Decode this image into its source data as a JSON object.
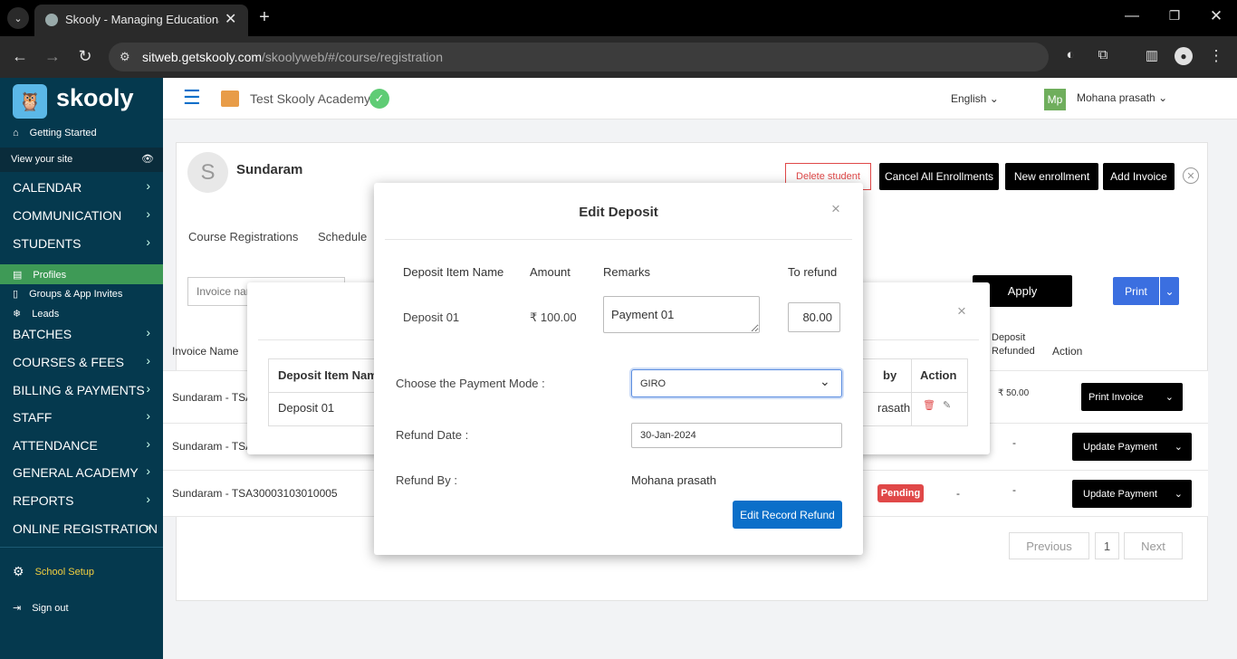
{
  "browser": {
    "tab_title": "Skooly - Managing Educational",
    "url_domain": "sitweb.getskooly.com",
    "url_path": "/skoolyweb/#/course/registration"
  },
  "sidebar": {
    "brand": "skooly",
    "getting_started": "Getting Started",
    "view_site": "View your site",
    "menu": [
      {
        "label": "CALENDAR"
      },
      {
        "label": "COMMUNICATION"
      },
      {
        "label": "STUDENTS"
      }
    ],
    "sub": {
      "profiles": "Profiles",
      "groups": "Groups & App Invites",
      "leads": "Leads"
    },
    "menu2": [
      {
        "label": "BATCHES"
      },
      {
        "label": "COURSES & FEES"
      },
      {
        "label": "BILLING & PAYMENTS"
      },
      {
        "label": "STAFF"
      },
      {
        "label": "ATTENDANCE"
      },
      {
        "label": "GENERAL ACADEMY"
      },
      {
        "label": "REPORTS"
      },
      {
        "label": "ONLINE REGISTRATION"
      }
    ],
    "school_setup": "School Setup",
    "sign_out": "Sign out"
  },
  "header": {
    "academy": "Test Skooly Academy",
    "language": "English",
    "avatar": "Mp",
    "user": "Mohana prasath"
  },
  "student": {
    "initial": "S",
    "name": "Sundaram",
    "delete": "Delete student",
    "cancel_all": "Cancel All Enrollments",
    "new_enroll": "New enrollment",
    "add_invoice": "Add Invoice",
    "tab1": "Course Registrations",
    "tab2": "Schedule",
    "invoice_placeholder": "Invoice name",
    "apply": "Apply",
    "print": "Print"
  },
  "table": {
    "col_invoice": "Invoice Name",
    "col_deposit1": "Deposit",
    "col_deposit2": "Refunded",
    "col_action": "Action",
    "rows": [
      {
        "name": "Sundaram - TSA",
        "deposit": "₹ 50.00",
        "action": "Print Invoice"
      },
      {
        "name": "Sundaram - TSA",
        "deposit": "-",
        "action": "Update Payment"
      },
      {
        "name": "Sundaram - TSA30003103010005",
        "status": "Pending",
        "dash": "-",
        "deposit": "-",
        "action": "Update Payment"
      }
    ],
    "prev": "Previous",
    "page": "1",
    "next": "Next"
  },
  "back_modal": {
    "col1": "Deposit Item Name",
    "col_by": "by",
    "col_action": "Action",
    "item": "Deposit 01",
    "by_val": "rasath"
  },
  "modal": {
    "title": "Edit Deposit",
    "h_item": "Deposit Item Name",
    "h_amount": "Amount",
    "h_remarks": "Remarks",
    "h_refund": "To refund",
    "item": "Deposit 01",
    "amount": "₹ 100.00",
    "remarks": "Payment 01",
    "refund": "80.00",
    "mode_label": "Choose the Payment Mode :",
    "mode_value": "GIRO",
    "date_label": "Refund Date :",
    "date_value": "30-Jan-2024",
    "by_label": "Refund By :",
    "by_value": "Mohana prasath",
    "submit": "Edit Record Refund"
  },
  "colors": {
    "sidebar": "#05394e",
    "accent": "#0b6fc9",
    "active": "#3e9a56",
    "pending": "#e04848"
  }
}
